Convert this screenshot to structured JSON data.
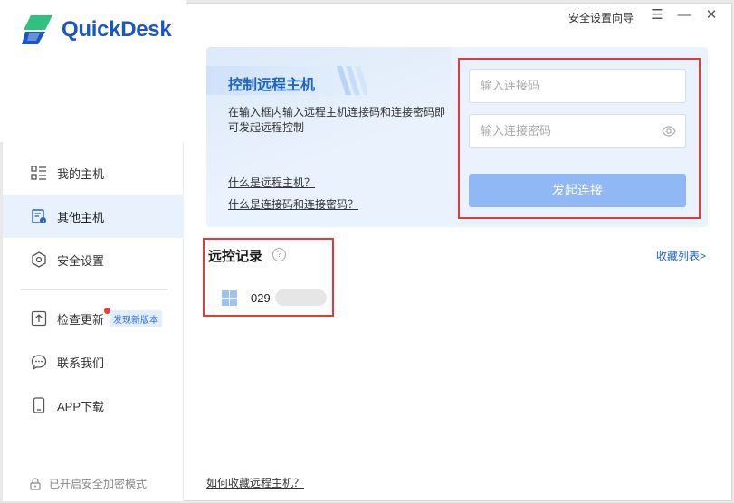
{
  "app": {
    "name": "QuickDesk"
  },
  "titlebar": {
    "guide": "安全设置向导",
    "menu": "☰",
    "minimize": "—",
    "close": "✕"
  },
  "sidebar": {
    "items": [
      {
        "label": "我的主机",
        "icon": "list-icon"
      },
      {
        "label": "其他主机",
        "icon": "screen-icon",
        "active": true
      },
      {
        "label": "安全设置",
        "icon": "shield-hex-icon"
      },
      {
        "label": "检查更新",
        "icon": "upload-icon",
        "badge": "发现新版本"
      },
      {
        "label": "联系我们",
        "icon": "chat-icon"
      },
      {
        "label": "APP下载",
        "icon": "phone-icon"
      }
    ],
    "secure_mode": "已开启安全加密模式"
  },
  "connect": {
    "title": "控制远程主机",
    "description": "在输入框内输入远程主机连接码和连接密码即可发起远程控制",
    "link_what_host": "什么是远程主机？",
    "link_what_codes": "什么是连接码和连接密码？",
    "code_placeholder": "输入连接码",
    "password_placeholder": "输入连接密码",
    "button": "发起连接"
  },
  "history": {
    "title": "远控记录",
    "help": "?",
    "favorites_link": "收藏列表>",
    "items": [
      {
        "id": "029"
      }
    ]
  },
  "footer": {
    "how_to_favorite": "如何收藏远程主机？"
  },
  "colors": {
    "accent": "#1c63c7",
    "active_bg": "#e9f1fd",
    "button": "#8fb8f4",
    "highlight": "#e53935"
  }
}
